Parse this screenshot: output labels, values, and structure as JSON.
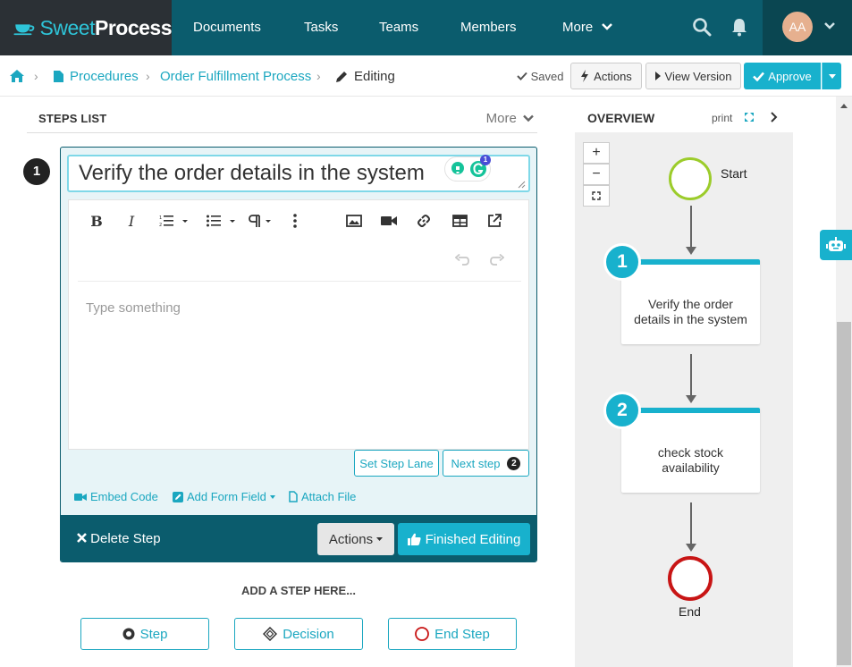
{
  "brand": {
    "sweet": "Sweet",
    "process": "Process"
  },
  "nav": {
    "items": [
      "Documents",
      "Tasks",
      "Teams",
      "Members",
      "More"
    ],
    "avatar_initials": "AA"
  },
  "breadcrumb": {
    "items": [
      "Procedures",
      "Order Fulfillment Process"
    ],
    "current": "Editing"
  },
  "toolbar": {
    "saved": "Saved",
    "actions": "Actions",
    "view_version": "View Version",
    "approve": "Approve"
  },
  "steps_list": {
    "title": "STEPS LIST",
    "more": "More"
  },
  "editor": {
    "step_number": "1",
    "title_value": "Verify the order details in the system",
    "grammarly_count": "1",
    "body_placeholder": "Type something",
    "set_step_lane": "Set Step Lane",
    "next_step": "Next step",
    "next_step_number": "2",
    "embed_code": "Embed Code",
    "add_form_field": "Add Form Field",
    "attach_file": "Attach File",
    "delete_step": "Delete Step",
    "actions": "Actions",
    "finished_editing": "Finished Editing"
  },
  "add_step": {
    "heading": "ADD A STEP HERE...",
    "step": "Step",
    "decision": "Decision",
    "end_step": "End Step"
  },
  "overview": {
    "title": "OVERVIEW",
    "print": "print",
    "start_label": "Start",
    "end_label": "End",
    "nodes": [
      {
        "number": "1",
        "line1": "Verify the order",
        "line2": "details in the system"
      },
      {
        "number": "2",
        "line1": "check stock",
        "line2": "availability"
      }
    ],
    "zoom_in": "+",
    "zoom_out": "−"
  },
  "colors": {
    "nav_bg": "#0b5c6d",
    "accent": "#18b1cd",
    "start_green": "#9ccc2b",
    "end_red": "#c81515"
  }
}
